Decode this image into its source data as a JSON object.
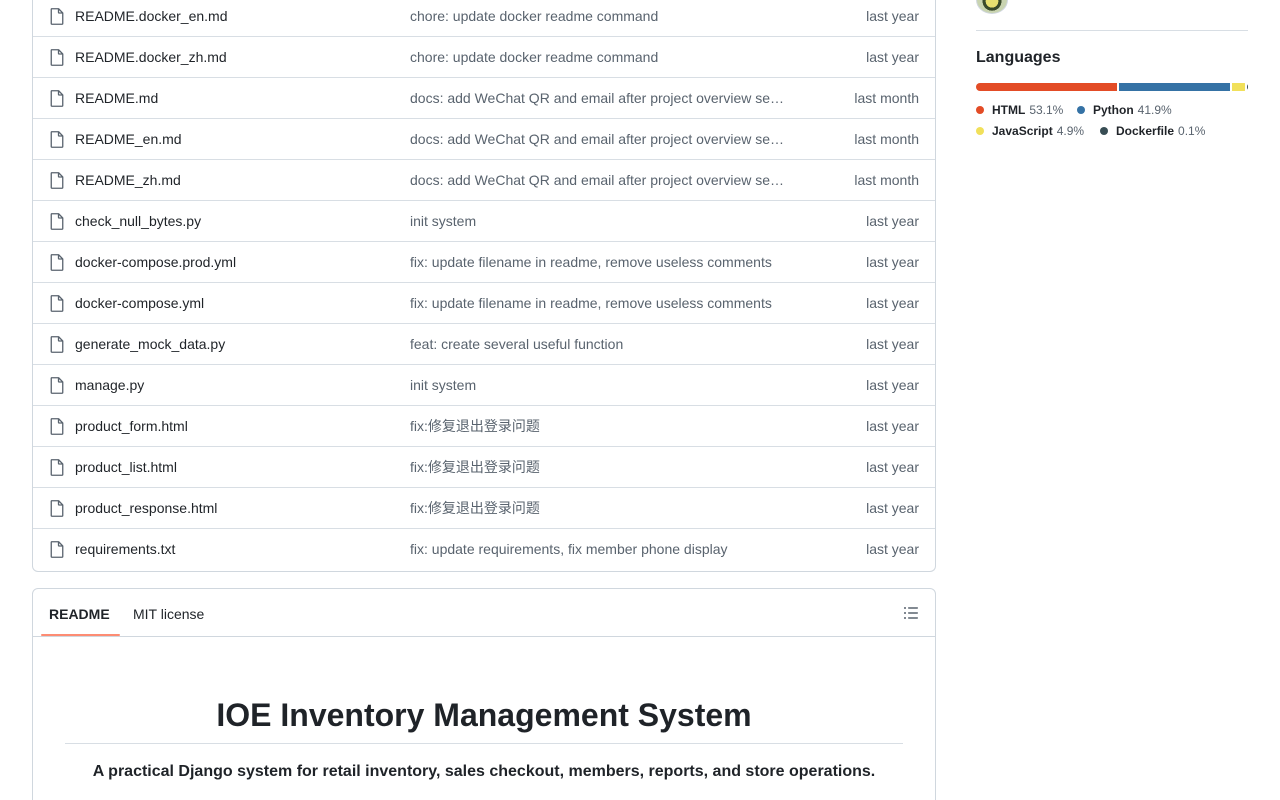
{
  "files": [
    {
      "name": "README.docker_en.md",
      "message": "chore: update docker readme command",
      "time": "last year"
    },
    {
      "name": "README.docker_zh.md",
      "message": "chore: update docker readme command",
      "time": "last year"
    },
    {
      "name": "README.md",
      "message": "docs: add WeChat QR and email after project overview se…",
      "time": "last month"
    },
    {
      "name": "README_en.md",
      "message": "docs: add WeChat QR and email after project overview se…",
      "time": "last month"
    },
    {
      "name": "README_zh.md",
      "message": "docs: add WeChat QR and email after project overview se…",
      "time": "last month"
    },
    {
      "name": "check_null_bytes.py",
      "message": "init system",
      "time": "last year"
    },
    {
      "name": "docker-compose.prod.yml",
      "message": "fix: update filename in readme, remove useless comments",
      "time": "last year"
    },
    {
      "name": "docker-compose.yml",
      "message": "fix: update filename in readme, remove useless comments",
      "time": "last year"
    },
    {
      "name": "generate_mock_data.py",
      "message": "feat: create several useful function",
      "time": "last year"
    },
    {
      "name": "manage.py",
      "message": "init system",
      "time": "last year"
    },
    {
      "name": "product_form.html",
      "message": "fix:修复退出登录问题",
      "time": "last year"
    },
    {
      "name": "product_list.html",
      "message": "fix:修复退出登录问题",
      "time": "last year"
    },
    {
      "name": "product_response.html",
      "message": "fix:修复退出登录问题",
      "time": "last year"
    },
    {
      "name": "requirements.txt",
      "message": "fix: update requirements, fix member phone display",
      "time": "last year"
    }
  ],
  "readme": {
    "tabs": [
      "README",
      "MIT license"
    ],
    "active_tab": "README",
    "title": "IOE Inventory Management System",
    "subtitle": "A practical Django system for retail inventory, sales checkout, members, reports, and store operations."
  },
  "sidebar": {
    "languages_title": "Languages",
    "languages": [
      {
        "name": "HTML",
        "percent": "53.1%",
        "value": 53.1,
        "color": "#e34c26"
      },
      {
        "name": "Python",
        "percent": "41.9%",
        "value": 41.9,
        "color": "#3572A5"
      },
      {
        "name": "JavaScript",
        "percent": "4.9%",
        "value": 4.9,
        "color": "#f1e05a"
      },
      {
        "name": "Dockerfile",
        "percent": "0.1%",
        "value": 0.1,
        "color": "#384d54"
      }
    ]
  },
  "icons": {
    "file": "file-icon",
    "outline": "list-unordered-icon"
  }
}
